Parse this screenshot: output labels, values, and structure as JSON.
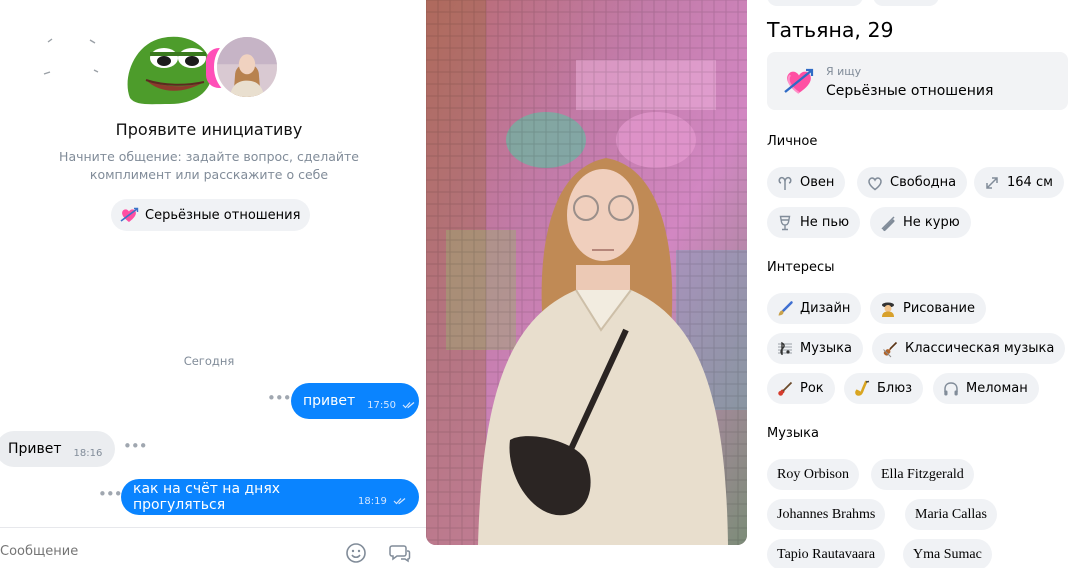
{
  "chat": {
    "initiative_title": "Проявите инициативу",
    "initiative_subtitle": "Начните общение: задайте вопрос, сделайте комплимент или расскажите о себе",
    "initiative_chip": "Серьёзные отношения",
    "day_separator": "Сегодня",
    "messages": [
      {
        "direction": "out",
        "text": "привет",
        "time": "17:50"
      },
      {
        "direction": "in",
        "text": "Привет",
        "time": "18:16"
      },
      {
        "direction": "out",
        "text": "как на счёт на днях прогуляться",
        "time": "18:19"
      }
    ],
    "composer_placeholder": "Сообщение"
  },
  "profile": {
    "name": "Татьяна, 29",
    "seeking_label": "Я ищу",
    "seeking_value": "Серьёзные отношения",
    "personal_heading": "Личное",
    "personal": [
      {
        "icon": "aries-icon",
        "label": "Овен"
      },
      {
        "icon": "heart-outline-icon",
        "label": "Свободна"
      },
      {
        "icon": "height-icon",
        "label": "164 см"
      },
      {
        "icon": "wine-glass-icon",
        "label": "Не пью"
      },
      {
        "icon": "no-smoking-icon",
        "label": "Не курю"
      }
    ],
    "interests_heading": "Интересы",
    "interests": [
      {
        "icon": "paintbrush-icon",
        "label": "Дизайн"
      },
      {
        "icon": "artist-icon",
        "label": "Рисование"
      },
      {
        "icon": "music-notes-icon",
        "label": "Музыка"
      },
      {
        "icon": "violin-icon",
        "label": "Классическая музыка"
      },
      {
        "icon": "guitar-icon",
        "label": "Рок"
      },
      {
        "icon": "saxophone-icon",
        "label": "Блюз"
      },
      {
        "icon": "headphones-icon",
        "label": "Меломан"
      }
    ],
    "music_heading": "Музыка",
    "music": [
      "Roy Orbison",
      "Ella Fitzgerald",
      "Johannes Brahms",
      "Maria Callas",
      "Tapio Rautavaara",
      "Yma Sumac"
    ]
  },
  "colors": {
    "accent_blue": "#0a84ff",
    "chip_bg": "#f0f2f5",
    "muted_text": "#818c99",
    "pink": "#ff4fb8"
  }
}
